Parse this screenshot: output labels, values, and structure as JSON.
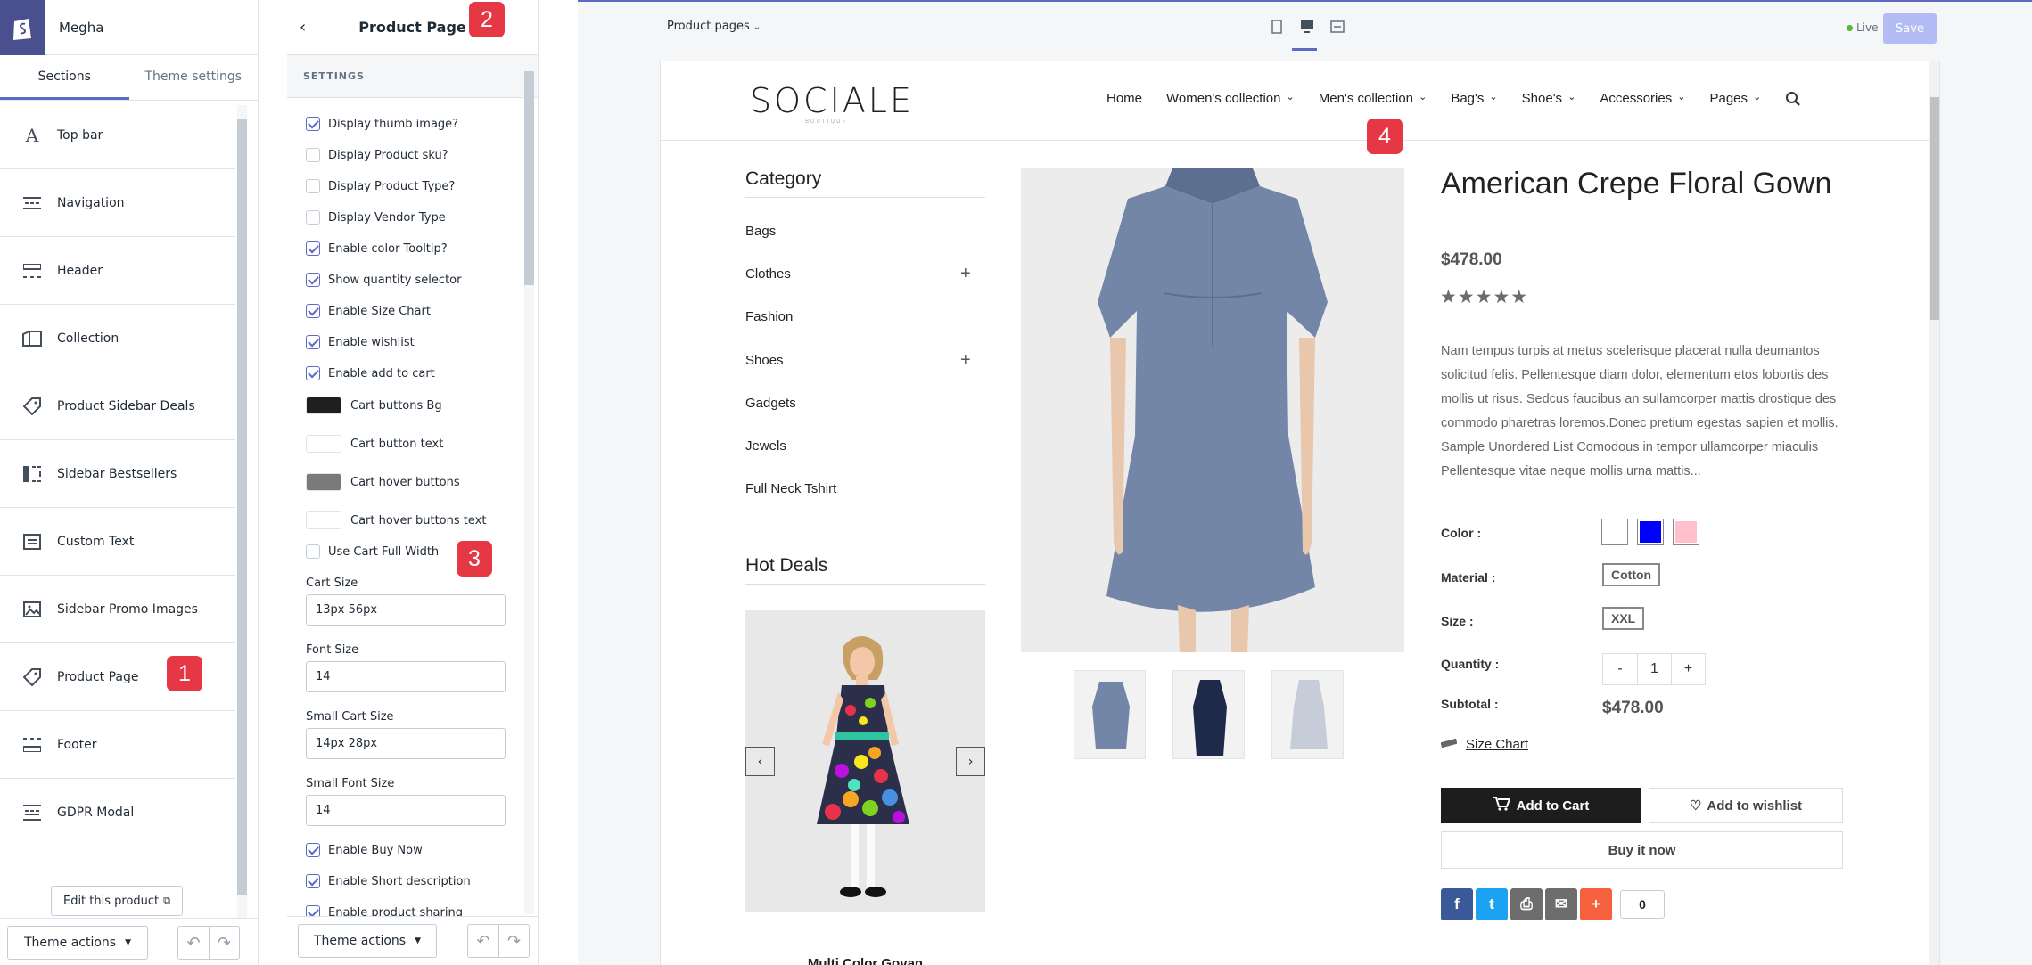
{
  "sidebar": {
    "shop_name": "Megha",
    "tabs": [
      {
        "label": "Sections",
        "active": true
      },
      {
        "label": "Theme settings",
        "active": false
      }
    ],
    "items": [
      {
        "label": "Top bar",
        "icon": "font-icon"
      },
      {
        "label": "Navigation",
        "icon": "navigation-icon"
      },
      {
        "label": "Header",
        "icon": "header-icon"
      },
      {
        "label": "Collection",
        "icon": "collection-icon"
      },
      {
        "label": "Product Sidebar Deals",
        "icon": "tag-icon"
      },
      {
        "label": "Sidebar Bestsellers",
        "icon": "sidebar-icon"
      },
      {
        "label": "Custom Text",
        "icon": "text-icon"
      },
      {
        "label": "Sidebar Promo Images",
        "icon": "image-icon"
      },
      {
        "label": "Product Page",
        "icon": "tag-icon"
      },
      {
        "label": "Footer",
        "icon": "footer-icon"
      },
      {
        "label": "GDPR Modal",
        "icon": "modal-icon"
      }
    ],
    "edit_button": "Edit this product",
    "theme_actions": "Theme actions"
  },
  "settings": {
    "title": "Product Page",
    "section_heading": "SETTINGS",
    "checkboxes_top": [
      {
        "label": "Display thumb image?",
        "checked": true
      },
      {
        "label": "Display Product sku?",
        "checked": false
      },
      {
        "label": "Display Product Type?",
        "checked": false
      },
      {
        "label": "Display Vendor Type",
        "checked": false
      },
      {
        "label": "Enable color Tooltip?",
        "checked": true
      },
      {
        "label": "Show quantity selector",
        "checked": true
      },
      {
        "label": "Enable Size Chart",
        "checked": true
      },
      {
        "label": "Enable wishlist",
        "checked": true
      },
      {
        "label": "Enable add to cart",
        "checked": true
      }
    ],
    "color_settings": [
      {
        "label": "Cart buttons Bg",
        "color": "#1f1f1f"
      },
      {
        "label": "Cart button text",
        "color": "#ffffff"
      },
      {
        "label": "Cart hover buttons",
        "color": "#7a7a7a"
      },
      {
        "label": "Cart hover buttons text",
        "color": "#ffffff"
      }
    ],
    "use_full_width": {
      "label": "Use Cart Full Width",
      "checked": false
    },
    "fields": [
      {
        "label": "Cart Size",
        "value": "13px  56px"
      },
      {
        "label": "Font Size",
        "value": "14"
      },
      {
        "label": "Small Cart Size",
        "value": "14px 28px"
      },
      {
        "label": "Small Font Size",
        "value": "14"
      }
    ],
    "checkboxes_bottom": [
      {
        "label": "Enable Buy Now",
        "checked": true
      },
      {
        "label": "Enable Short description",
        "checked": true
      },
      {
        "label": "Enable product sharing",
        "checked": true
      }
    ],
    "theme_actions": "Theme actions"
  },
  "badges": [
    "1",
    "2",
    "3",
    "4"
  ],
  "preview": {
    "page_selector": "Product pages",
    "devices": [
      "mobile-icon",
      "desktop-icon",
      "fullscreen-icon"
    ],
    "live_label": "Live",
    "save_label": "Save",
    "store": {
      "logo": "SOCIALE",
      "logo_sub": "BOUTIQUE",
      "nav": [
        {
          "label": "Home",
          "dropdown": false
        },
        {
          "label": "Women's collection",
          "dropdown": true
        },
        {
          "label": "Men's collection",
          "dropdown": true
        },
        {
          "label": "Bag's",
          "dropdown": true
        },
        {
          "label": "Shoe's",
          "dropdown": true
        },
        {
          "label": "Accessories",
          "dropdown": true
        },
        {
          "label": "Pages",
          "dropdown": true
        }
      ],
      "category_title": "Category",
      "categories": [
        {
          "label": "Bags",
          "expandable": false
        },
        {
          "label": "Clothes",
          "expandable": true
        },
        {
          "label": "Fashion",
          "expandable": false
        },
        {
          "label": "Shoes",
          "expandable": true
        },
        {
          "label": "Gadgets",
          "expandable": false
        },
        {
          "label": "Jewels",
          "expandable": false
        },
        {
          "label": "Full Neck Tshirt",
          "expandable": false
        }
      ],
      "hot_deals_title": "Hot Deals",
      "deal_name": "Multi Color Govan",
      "product": {
        "title": "American Crepe Floral Gown",
        "price": "$478.00",
        "rating": 5,
        "description": "Nam tempus turpis at metus scelerisque placerat nulla deumantos solicitud felis. Pellentesque diam dolor, elementum etos lobortis des mollis ut risus. Sedcus faucibus an sullamcorper mattis drostique des commodo pharetras loremos.Donec pretium egestas sapien et mollis. Sample Unordered List Comodous in tempor ullamcorper miaculis Pellentesque vitae neque mollis urna mattis...",
        "color_label": "Color :",
        "colors": [
          "#ffffff",
          "#0000ff",
          "#ffc0cb"
        ],
        "material_label": "Material :",
        "material": "Cotton",
        "size_label": "Size :",
        "size": "XXL",
        "quantity_label": "Quantity :",
        "quantity_minus": "-",
        "quantity": "1",
        "quantity_plus": "+",
        "subtotal_label": "Subtotal :",
        "subtotal": "$478.00",
        "size_chart": "Size Chart",
        "add_to_cart": "Add to Cart",
        "add_to_wishlist": "Add to wishlist",
        "buy_now": "Buy it now",
        "share_count": "0"
      }
    }
  }
}
